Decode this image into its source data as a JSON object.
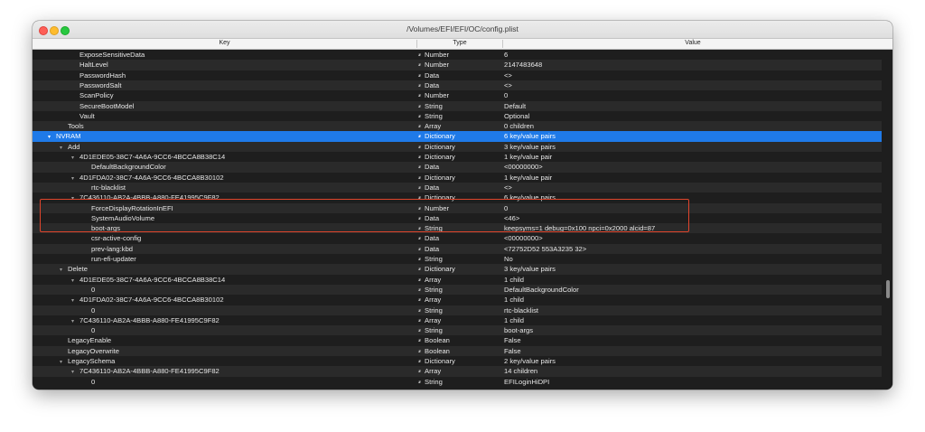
{
  "window": {
    "title": "/Volumes/EFI/EFI/OC/config.plist"
  },
  "columns": {
    "key": "Key",
    "type": "Type",
    "value": "Value"
  },
  "rows": [
    {
      "key": "ExposeSensitiveData",
      "indent": 3,
      "type": "Number",
      "value": "6"
    },
    {
      "key": "HaltLevel",
      "indent": 3,
      "type": "Number",
      "value": "2147483648"
    },
    {
      "key": "PasswordHash",
      "indent": 3,
      "type": "Data",
      "value": "<>"
    },
    {
      "key": "PasswordSalt",
      "indent": 3,
      "type": "Data",
      "value": "<>"
    },
    {
      "key": "ScanPolicy",
      "indent": 3,
      "type": "Number",
      "value": "0"
    },
    {
      "key": "SecureBootModel",
      "indent": 3,
      "type": "String",
      "value": "Default"
    },
    {
      "key": "Vault",
      "indent": 3,
      "type": "String",
      "value": "Optional"
    },
    {
      "key": "Tools",
      "indent": 2,
      "type": "Array",
      "value": "0 children"
    },
    {
      "key": "NVRAM",
      "indent": 1,
      "type": "Dictionary",
      "value": "6 key/value pairs",
      "expanded": true,
      "selected": true
    },
    {
      "key": "Add",
      "indent": 2,
      "type": "Dictionary",
      "value": "3 key/value pairs",
      "expanded": true
    },
    {
      "key": "4D1EDE05-38C7-4A6A-9CC6-4BCCA8B38C14",
      "indent": 3,
      "type": "Dictionary",
      "value": "1 key/value pair",
      "expanded": true
    },
    {
      "key": "DefaultBackgroundColor",
      "indent": 4,
      "type": "Data",
      "value": "<00000000>"
    },
    {
      "key": "4D1FDA02-38C7-4A6A-9CC6-4BCCA8B30102",
      "indent": 3,
      "type": "Dictionary",
      "value": "1 key/value pair",
      "expanded": true
    },
    {
      "key": "rtc-blacklist",
      "indent": 4,
      "type": "Data",
      "value": "<>"
    },
    {
      "key": "7C436110-AB2A-4BBB-A880-FE41995C9F82",
      "indent": 3,
      "type": "Dictionary",
      "value": "6 key/value pairs",
      "expanded": true
    },
    {
      "key": "ForceDisplayRotationInEFI",
      "indent": 4,
      "type": "Number",
      "value": "0"
    },
    {
      "key": "SystemAudioVolume",
      "indent": 4,
      "type": "Data",
      "value": "<46>"
    },
    {
      "key": "boot-args",
      "indent": 4,
      "type": "String",
      "value": "keepsyms=1 debug=0x100 npci=0x2000 alcid=87"
    },
    {
      "key": "csr-active-config",
      "indent": 4,
      "type": "Data",
      "value": "<00000000>"
    },
    {
      "key": "prev-lang:kbd",
      "indent": 4,
      "type": "Data",
      "value": "<72752D52 553A3235 32>"
    },
    {
      "key": "run-efi-updater",
      "indent": 4,
      "type": "String",
      "value": "No"
    },
    {
      "key": "Delete",
      "indent": 2,
      "type": "Dictionary",
      "value": "3 key/value pairs",
      "expanded": true
    },
    {
      "key": "4D1EDE05-38C7-4A6A-9CC6-4BCCA8B38C14",
      "indent": 3,
      "type": "Array",
      "value": "1 child",
      "expanded": true
    },
    {
      "key": "0",
      "indent": 4,
      "type": "String",
      "value": "DefaultBackgroundColor"
    },
    {
      "key": "4D1FDA02-38C7-4A6A-9CC6-4BCCA8B30102",
      "indent": 3,
      "type": "Array",
      "value": "1 child",
      "expanded": true
    },
    {
      "key": "0",
      "indent": 4,
      "type": "String",
      "value": "rtc-blacklist"
    },
    {
      "key": "7C436110-AB2A-4BBB-A880-FE41995C9F82",
      "indent": 3,
      "type": "Array",
      "value": "1 child",
      "expanded": true
    },
    {
      "key": "0",
      "indent": 4,
      "type": "String",
      "value": "boot-args"
    },
    {
      "key": "LegacyEnable",
      "indent": 2,
      "type": "Boolean",
      "value": "False"
    },
    {
      "key": "LegacyOverwrite",
      "indent": 2,
      "type": "Boolean",
      "value": "False"
    },
    {
      "key": "LegacySchema",
      "indent": 2,
      "type": "Dictionary",
      "value": "2 key/value pairs",
      "expanded": true
    },
    {
      "key": "7C436110-AB2A-4BBB-A880-FE41995C9F82",
      "indent": 3,
      "type": "Array",
      "value": "14 children",
      "expanded": true
    },
    {
      "key": "0",
      "indent": 4,
      "type": "String",
      "value": "EFILoginHiDPI"
    }
  ],
  "colors": {
    "selection": "#1f7ae8",
    "highlight": "#e0452c",
    "background": "#1e1e1e"
  },
  "icons": {
    "stepper": "updown-stepper-icon",
    "disclosure": "disclosure-triangle-icon"
  }
}
